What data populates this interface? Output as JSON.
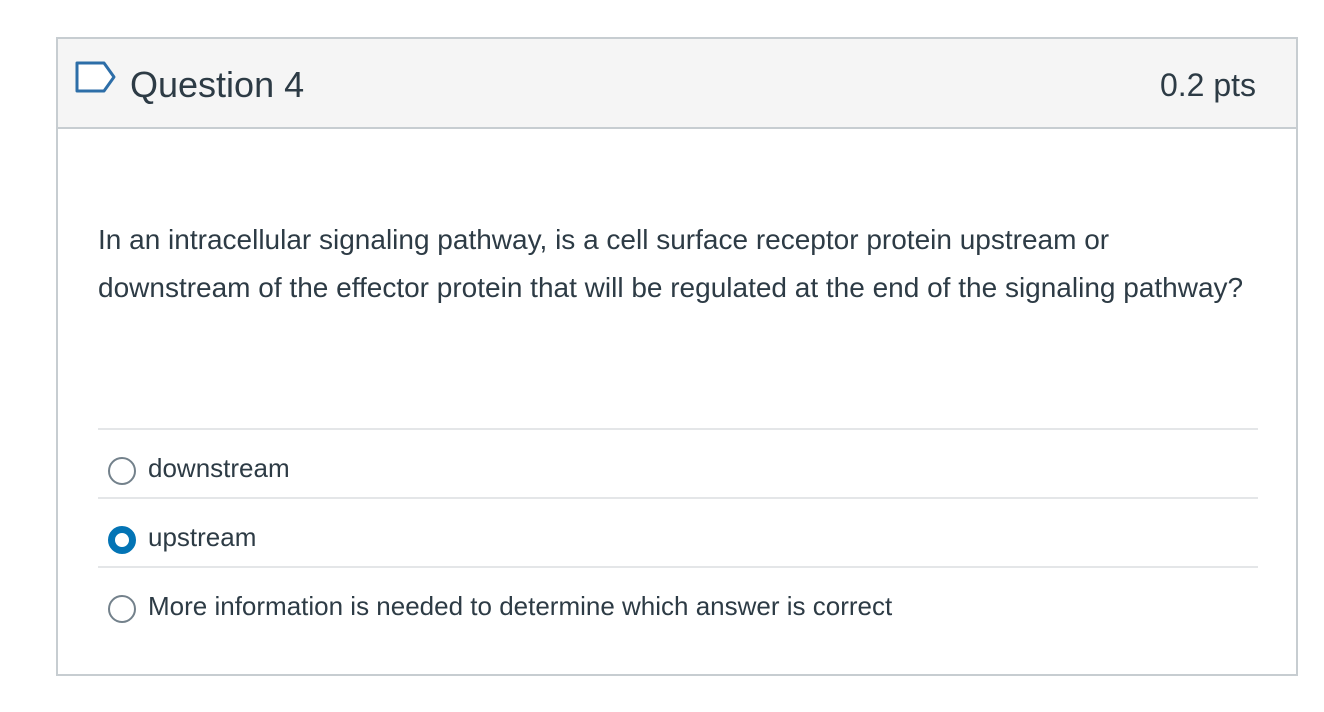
{
  "question": {
    "title": "Question 4",
    "points": "0.2 pts",
    "flag_icon": "flag-question-icon",
    "text": "In an intracellular signaling pathway, is a cell surface receptor protein upstream or downstream of the effector protein that will be regulated at the end of the signaling pathway?",
    "answers": [
      {
        "label": "downstream",
        "selected": false
      },
      {
        "label": "upstream",
        "selected": true
      },
      {
        "label": "More information is needed to determine which answer is correct",
        "selected": false
      }
    ]
  },
  "colors": {
    "accent": "#0374b5",
    "text": "#2d3b45",
    "border": "#c7cdd1",
    "header_bg": "#f5f5f5"
  }
}
